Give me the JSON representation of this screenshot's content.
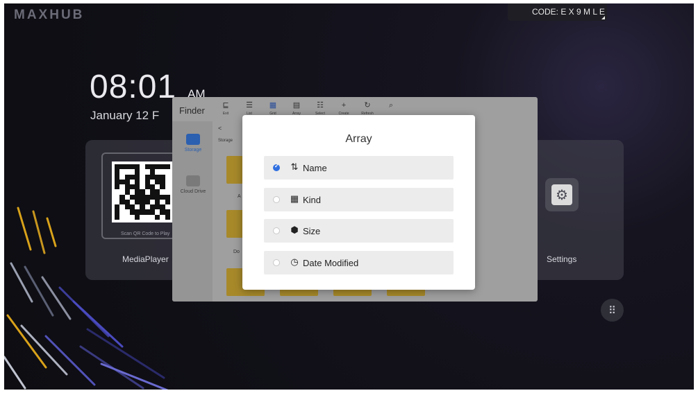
{
  "brand": {
    "logo": "MAXHUB"
  },
  "code_badge": {
    "text": "CODE: E X 9 M L E"
  },
  "clock": {
    "time": "08:01",
    "ampm": "AM",
    "date": "January 12  F"
  },
  "home": {
    "scan_text": "Scan QR Code to Play",
    "mediaplayer_label": "MediaPlayer",
    "settings_label": "Settings",
    "apps_icon": "grid-dots-icon"
  },
  "finder": {
    "title": "Finder",
    "toolbar": [
      {
        "icon": "⊑",
        "label": "Exit"
      },
      {
        "icon": "☰",
        "label": "List"
      },
      {
        "icon": "▦",
        "label": "Grid"
      },
      {
        "icon": "▤",
        "label": "Array"
      },
      {
        "icon": "☷",
        "label": "Select"
      },
      {
        "icon": "+",
        "label": "Create"
      },
      {
        "icon": "↻",
        "label": "Refresh"
      },
      {
        "icon": "⌕",
        "label": ""
      }
    ],
    "back": "<",
    "breadcrumb": "Storage",
    "sidebar": [
      {
        "label": "Storage"
      },
      {
        "label": "Cloud Drive"
      }
    ],
    "folder_labels": [
      "A",
      "Do"
    ]
  },
  "modal": {
    "title": "Array",
    "options": [
      {
        "label": "Name",
        "icon": "sort-az-icon",
        "glyph": "⇅",
        "checked": true
      },
      {
        "label": "Kind",
        "icon": "kind-grid-icon",
        "glyph": "▦",
        "checked": false
      },
      {
        "label": "Size",
        "icon": "size-icon",
        "glyph": "⬢",
        "checked": false
      },
      {
        "label": "Date Modified",
        "icon": "clock-icon",
        "glyph": "◷",
        "checked": false
      }
    ]
  },
  "colors": {
    "accent": "#2f6fe0",
    "background": "#111018",
    "modal": "#ffffff",
    "option_bg": "#ececec"
  }
}
